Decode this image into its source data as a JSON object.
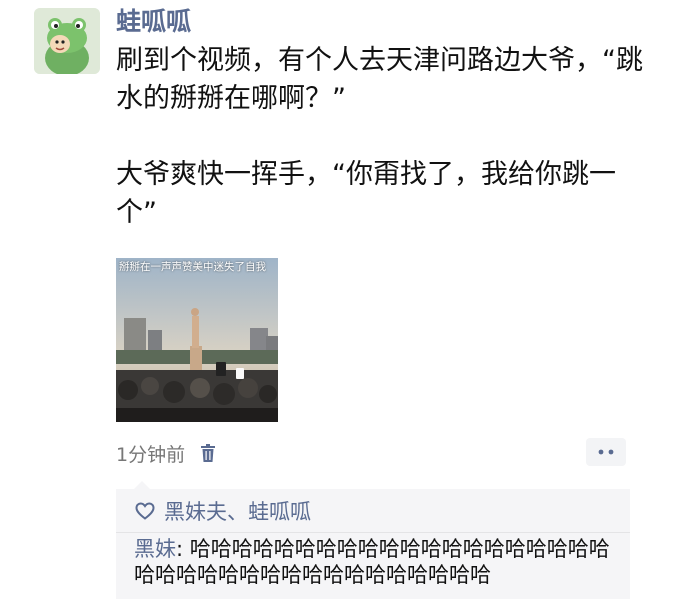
{
  "post": {
    "username": "蛙呱呱",
    "avatar_icon": "frog-avatar-icon",
    "paragraphs": [
      "刷到个视频，有个人去天津问路边大爷，“跳水的掰掰在哪啊？”",
      "大爷爽快一挥手，“你甭找了，我给你跳一个”"
    ],
    "image": {
      "caption": "掰掰在一声声赞美中迷失了自我"
    },
    "timestamp": "1分钟前",
    "delete_icon": "trash-icon",
    "more_icon": "more-dots-icon"
  },
  "interactions": {
    "like_icon": "heart-icon",
    "likes": "黑妹夫、蛙呱呱",
    "comments": [
      {
        "author": "黑妹",
        "separator": ": ",
        "text": "哈哈哈哈哈哈哈哈哈哈哈哈哈哈哈哈哈哈哈哈哈哈哈哈哈哈哈哈哈哈哈哈哈哈哈哈哈"
      }
    ]
  },
  "colors": {
    "accent_name": "#5a6b91",
    "text": "#111111",
    "muted": "#777777",
    "comment_bg": "#f5f5f7"
  }
}
